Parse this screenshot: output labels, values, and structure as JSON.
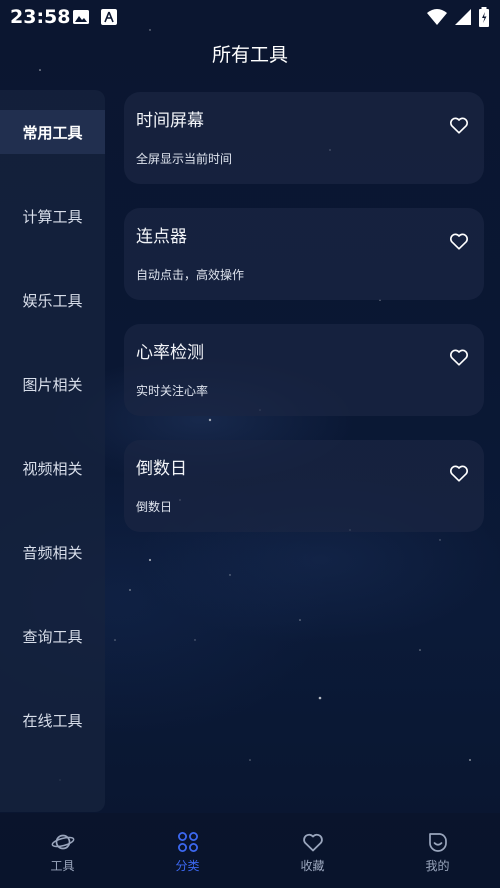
{
  "status_bar": {
    "time": "23:58"
  },
  "header": {
    "title": "所有工具"
  },
  "sidebar": {
    "items": [
      {
        "label": "常用工具",
        "active": true
      },
      {
        "label": "计算工具",
        "active": false
      },
      {
        "label": "娱乐工具",
        "active": false
      },
      {
        "label": "图片相关",
        "active": false
      },
      {
        "label": "视频相关",
        "active": false
      },
      {
        "label": "音频相关",
        "active": false
      },
      {
        "label": "查询工具",
        "active": false
      },
      {
        "label": "在线工具",
        "active": false
      }
    ]
  },
  "tools": [
    {
      "title": "时间屏幕",
      "desc": "全屏显示当前时间",
      "icon": "heart-outline-icon"
    },
    {
      "title": "连点器",
      "desc": "自动点击，高效操作",
      "icon": "heart-outline-icon"
    },
    {
      "title": "心率检测",
      "desc": "实时关注心率",
      "icon": "heart-outline-icon"
    },
    {
      "title": "倒数日",
      "desc": "倒数日",
      "icon": "heart-outline-icon"
    }
  ],
  "bottom_nav": {
    "items": [
      {
        "label": "工具",
        "icon": "planet-icon",
        "active": false
      },
      {
        "label": "分类",
        "icon": "grid-dots-icon",
        "active": true
      },
      {
        "label": "收藏",
        "icon": "heart-icon",
        "active": false
      },
      {
        "label": "我的",
        "icon": "smile-icon",
        "active": false
      }
    ]
  },
  "colors": {
    "accent": "#3c68f0",
    "background": "#0b1630",
    "inactive": "#9aa6bd"
  }
}
